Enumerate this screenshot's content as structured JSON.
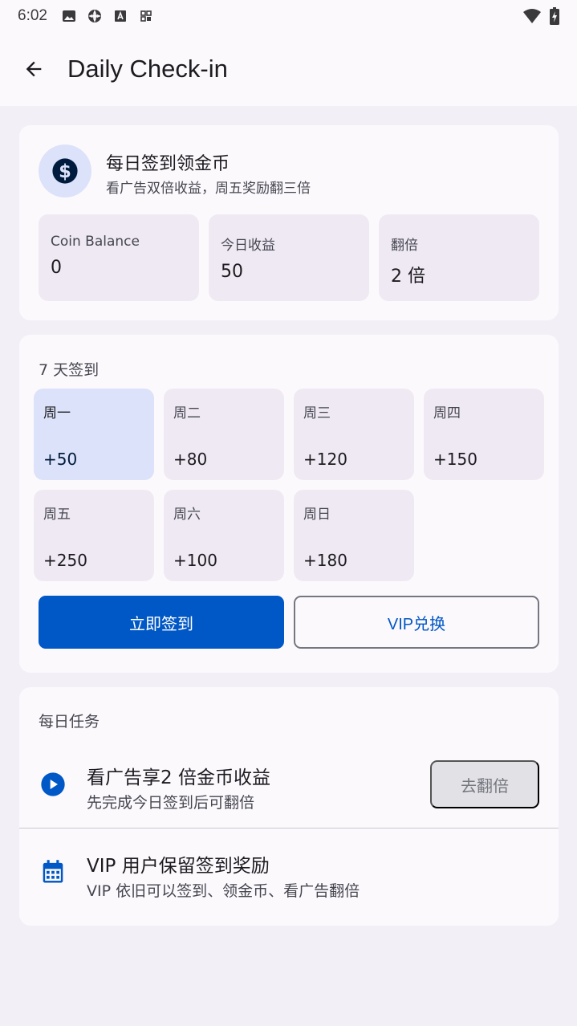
{
  "status_bar": {
    "time": "6:02",
    "left_icons": [
      "image-icon",
      "settings-cog-icon",
      "font-icon",
      "grid-icon"
    ],
    "right_icons": [
      "wifi-icon",
      "battery-icon"
    ]
  },
  "app_bar": {
    "title": "Daily Check-in",
    "back_icon": "arrow-back-icon"
  },
  "summary": {
    "icon": "dollar-coin-icon",
    "title": "每日签到领金币",
    "subtitle": "看广告双倍收益，周五奖励翻三倍",
    "stats": [
      {
        "label": "Coin Balance",
        "value": "0"
      },
      {
        "label": "今日收益",
        "value": "50"
      },
      {
        "label": "翻倍",
        "value": "2 倍"
      }
    ]
  },
  "checkin": {
    "title": "7 天签到",
    "days": [
      {
        "name": "周一",
        "reward": "+50",
        "active": true
      },
      {
        "name": "周二",
        "reward": "+80"
      },
      {
        "name": "周三",
        "reward": "+120"
      },
      {
        "name": "周四",
        "reward": "+150"
      },
      {
        "name": "周五",
        "reward": "+250"
      },
      {
        "name": "周六",
        "reward": "+100"
      },
      {
        "name": "周日",
        "reward": "+180"
      }
    ],
    "primary_button": "立即签到",
    "secondary_button": "VIP兑换"
  },
  "tasks": {
    "title": "每日任务",
    "items": [
      {
        "icon": "play-circle-icon",
        "title": "看广告享2 倍金币收益",
        "subtitle": "先完成今日签到后可翻倍",
        "action": "去翻倍"
      },
      {
        "icon": "calendar-icon",
        "title": "VIP 用户保留签到奖励",
        "subtitle": "VIP 依旧可以签到、领金币、看广告翻倍"
      }
    ]
  },
  "colors": {
    "primary": "#0057c6",
    "surface": "#fcf9fd",
    "background": "#f3eff6",
    "tile": "#efe9f4",
    "active_tile": "#dbe2f9"
  }
}
